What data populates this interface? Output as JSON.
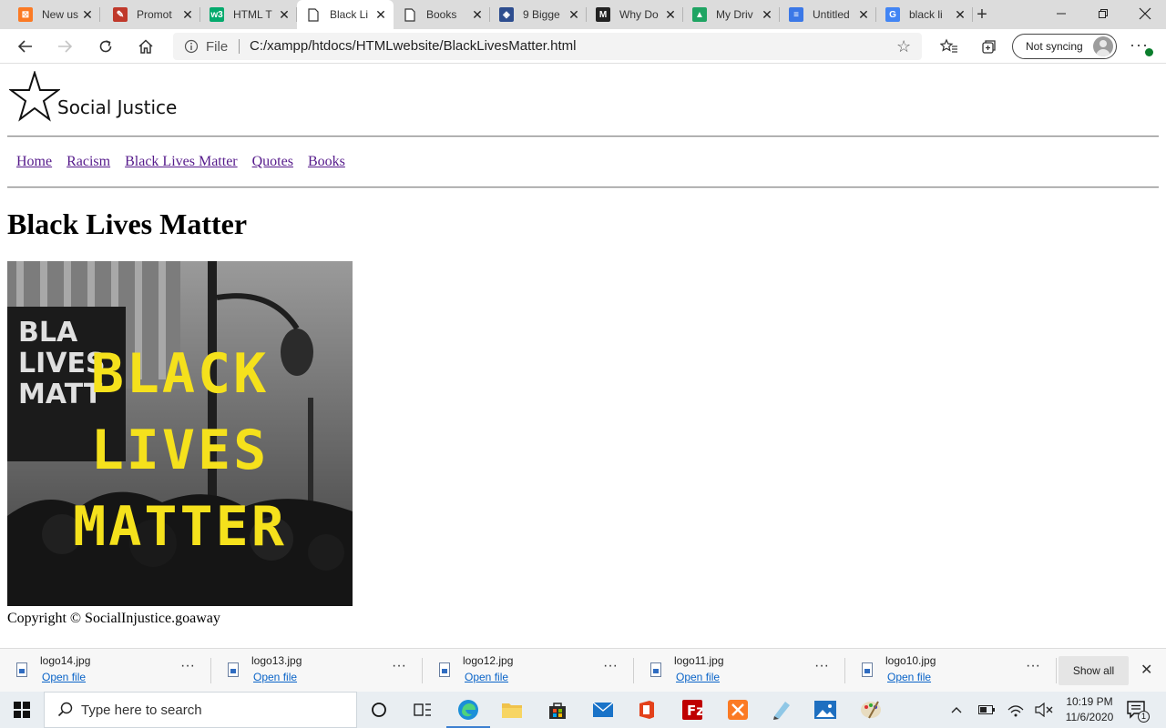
{
  "browser": {
    "tabs": [
      {
        "label": "New us",
        "favicon": "xampp-icon",
        "color": "#fb7a24",
        "glyph": "⊠",
        "active": false
      },
      {
        "label": "Promot",
        "favicon": "pen-icon",
        "color": "#c0392b",
        "glyph": "✎",
        "active": false
      },
      {
        "label": "HTML T",
        "favicon": "w3schools-icon",
        "color": "#04aa6d",
        "glyph": "w3",
        "active": false
      },
      {
        "label": "Black Li",
        "favicon": "page-icon",
        "color": "#555555",
        "glyph": "",
        "active": true
      },
      {
        "label": "Books",
        "favicon": "page-icon",
        "color": "#555555",
        "glyph": "",
        "active": false
      },
      {
        "label": "9 Bigge",
        "favicon": "shield-icon",
        "color": "#2d4d8f",
        "glyph": "◈",
        "active": false
      },
      {
        "label": "Why Do",
        "favicon": "medium-icon",
        "color": "#222222",
        "glyph": "M",
        "active": false
      },
      {
        "label": "My Driv",
        "favicon": "google-drive-icon",
        "color": "#1fa463",
        "glyph": "▲",
        "active": false
      },
      {
        "label": "Untitled",
        "favicon": "google-docs-icon",
        "color": "#3b78e7",
        "glyph": "≡",
        "active": false
      },
      {
        "label": "black li",
        "favicon": "google-icon",
        "color": "#4285f4",
        "glyph": "G",
        "active": false
      }
    ],
    "address": {
      "scheme_label": "File",
      "url": "C:/xampp/htdocs/HTMLwebsite/BlackLivesMatter.html"
    },
    "sync_label": "Not syncing"
  },
  "page": {
    "site_name": "Social Justice",
    "nav": [
      "Home",
      "Racism",
      "Black Lives Matter",
      "Quotes",
      "Books"
    ],
    "heading": "Black Lives Matter",
    "poster": {
      "lines": [
        "BLACK",
        "LIVES",
        "MATTER"
      ],
      "sign_lines": [
        "BLA",
        "LIVES",
        "MATT"
      ],
      "text_color": "#f5e11c"
    },
    "footer": "Copyright © SocialInjustice.goaway"
  },
  "downloads": {
    "items": [
      {
        "name": "logo14.jpg",
        "action": "Open file"
      },
      {
        "name": "logo13.jpg",
        "action": "Open file"
      },
      {
        "name": "logo12.jpg",
        "action": "Open file"
      },
      {
        "name": "logo11.jpg",
        "action": "Open file"
      },
      {
        "name": "logo10.jpg",
        "action": "Open file"
      }
    ],
    "show_all": "Show all"
  },
  "taskbar": {
    "search_placeholder": "Type here to search",
    "time": "10:19 PM",
    "date": "11/6/2020",
    "notification_count": "1"
  }
}
